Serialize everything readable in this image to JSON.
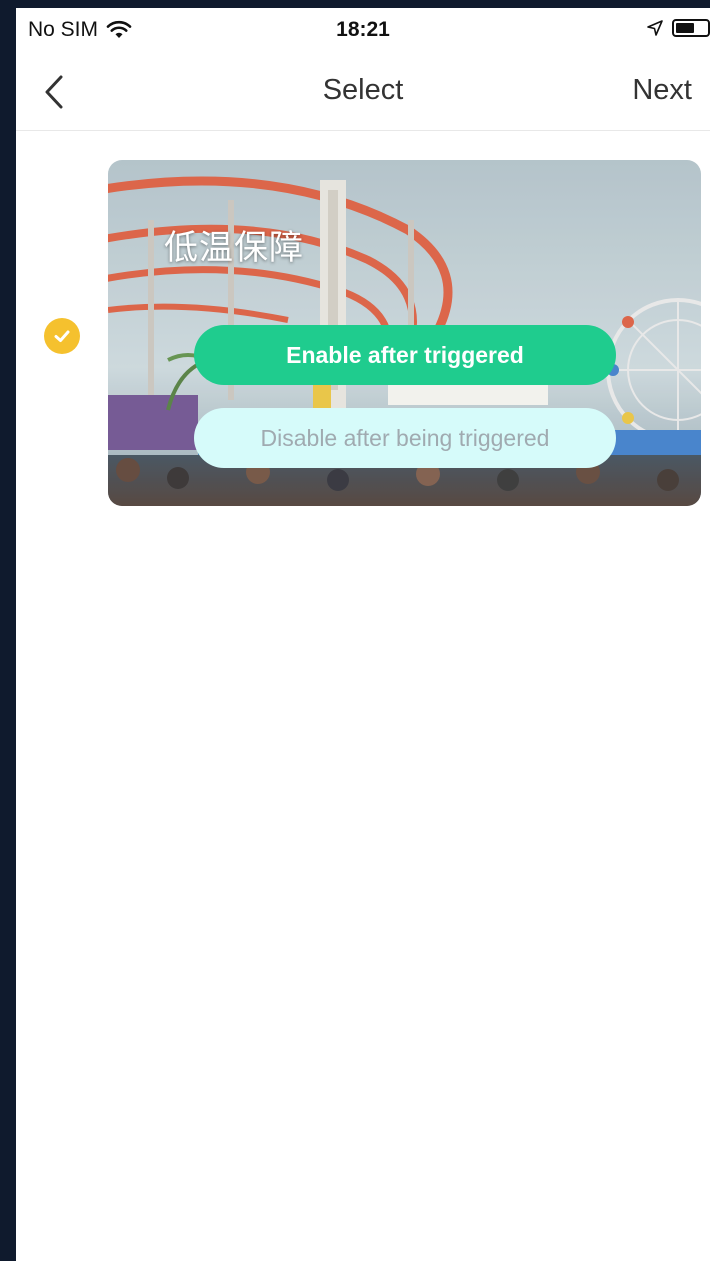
{
  "status_bar": {
    "carrier": "No SIM",
    "time": "18:21"
  },
  "nav": {
    "title": "Select",
    "next_label": "Next"
  },
  "scene": {
    "name": "低温保障",
    "selected": true,
    "enable_label": "Enable after triggered",
    "disable_label": "Disable after being triggered"
  },
  "colors": {
    "selected_check": "#f5c12e",
    "enable_button": "#1fcc8e",
    "disable_button": "#d6fbfa"
  }
}
